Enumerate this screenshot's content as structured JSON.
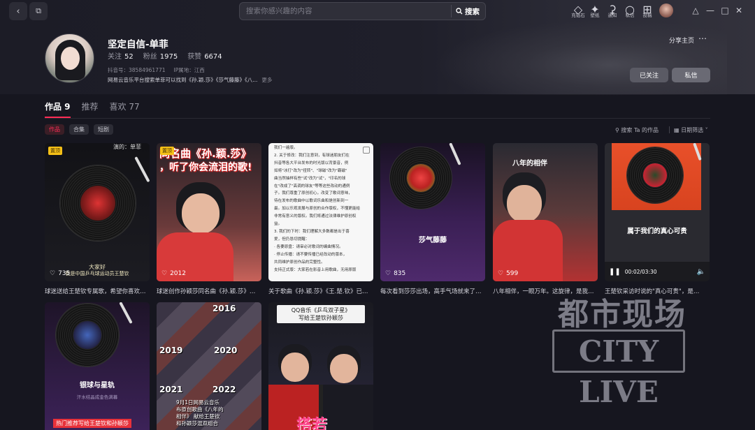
{
  "topbar": {
    "search_placeholder": "搜索你感兴趣的内容",
    "search_button": "搜索",
    "tools": [
      {
        "icon": "diamond-icon",
        "label": "充钻石"
      },
      {
        "icon": "wallpaper-icon",
        "label": "壁纸"
      },
      {
        "icon": "bell-icon",
        "label": "通知"
      },
      {
        "icon": "message-icon",
        "label": "私信"
      },
      {
        "icon": "upload-icon",
        "label": "投稿"
      }
    ]
  },
  "profile": {
    "name": "坚定自信-单菲",
    "following_label": "关注",
    "following": "52",
    "fans_label": "粉丝",
    "fans": "1975",
    "likes_label": "获赞",
    "likes": "6674",
    "douyin_id": "抖音号：38584961771",
    "ip": "IP属地：江西",
    "bio": "网易云音乐平台搜索单菲可以找到《孙.颖.莎》《莎气藤藤》《八...",
    "bio_more": "更多",
    "share": "分享主页",
    "followed_button": "已关注",
    "message_button": "私信"
  },
  "tabs": [
    {
      "label": "作品 9",
      "active": true
    },
    {
      "label": "推荐",
      "active": false
    },
    {
      "label": "喜欢 77",
      "active": false
    }
  ],
  "chips": [
    "作品",
    "合集",
    "短剧"
  ],
  "filters": {
    "search": "搜索 Ta 的作品",
    "date": "日期筛选"
  },
  "badge_top": "置顶",
  "cards": [
    {
      "likes": "735",
      "caption": "球迷送给王楚钦专属歌，希望你喜欢…",
      "overlay_top": "演的：单菲",
      "overlay_bottom1": "大家好",
      "overlay_bottom2": "我是中国乒乓球运动员王楚钦"
    },
    {
      "likes": "2012",
      "caption": "球迷创作孙颖莎同名曲《孙.颖.莎》…",
      "overlay_top": "同名曲《孙.颖.莎》",
      "overlay_top2": "，听了你会流泪的歌!"
    },
    {
      "likes": "",
      "caption": "关于歌曲《孙.颖.莎》《王.楚.钦》已…",
      "doc_lines": [
        "我们一遍版。",
        "2. 关于修改：我们注意到，有球迷朋友们在",
        "抖音等各大平台发布的时光版以背景音，例",
        "如将\"冰打\"改为\"扭转\"、\"球磁\"改为\"霸磁\"",
        "曲当然抽样有些\"试\"改为\"试\"，\"印名的球",
        "在\"改成了\"高调的球友\"等等这些改动的通例",
        "子。我们尊重了原创初心，改变了歌词意味，",
        "待在发布的歌曲中以歌词乐曲和是创新到一",
        "最。加以乐观发展与原创的合作版权，不懂更能给",
        "非常有意义的版权。我们将通过法律维护原创权",
        "益。",
        "3. 我们的下时：我们理解大多数都是出于喜",
        "爱，但仍恳切提醒：",
        "· 各要原盘：请审必对歌词的编曲情况。",
        "· 停止传播：请不要传播已经改动的版本，",
        "共同维护原创作品的完整性。",
        "支持正式版：大家若在影音上用歌曲，无用原版"
      ]
    },
    {
      "likes": "835",
      "caption": "每次看到莎莎出场，高手气场就来了…",
      "title": "莎气藤藤"
    },
    {
      "likes": "599",
      "caption": "八年相伴，一眼万年。这旋律，是我…",
      "overlay_top": "八年的相伴"
    },
    {
      "likes": "",
      "caption": "王楚钦采访时说的\"真心可贵\"，是…",
      "title": "属于我们的真心可贵",
      "time": "00:02/03:30"
    },
    {
      "likes": "",
      "caption": "",
      "title": "银球与星轨",
      "subtitle": "汗水结晶成金色满幕",
      "bottom_tag": "热门推荐写给王楚钦和孙颖莎"
    },
    {
      "likes": "",
      "caption": "",
      "years": [
        "2016",
        "2019",
        "2020",
        "2021",
        "2022"
      ],
      "overlay": "9月1日网易云音乐\n布原创歌曲《八年的\n相伴》 献给王楚钦\n和孙颖莎混双组合"
    },
    {
      "likes": "",
      "caption": "",
      "header1": "QQ音乐《乒乓双子星》",
      "header2": "写给王楚钦孙颖莎",
      "big": "搭若"
    }
  ],
  "watermark": {
    "top": "都市现场",
    "bottom": "CITY LIVE"
  },
  "colors": {
    "accent": "#fe2c55",
    "badge": "#f5c017",
    "background": "#16161f"
  }
}
